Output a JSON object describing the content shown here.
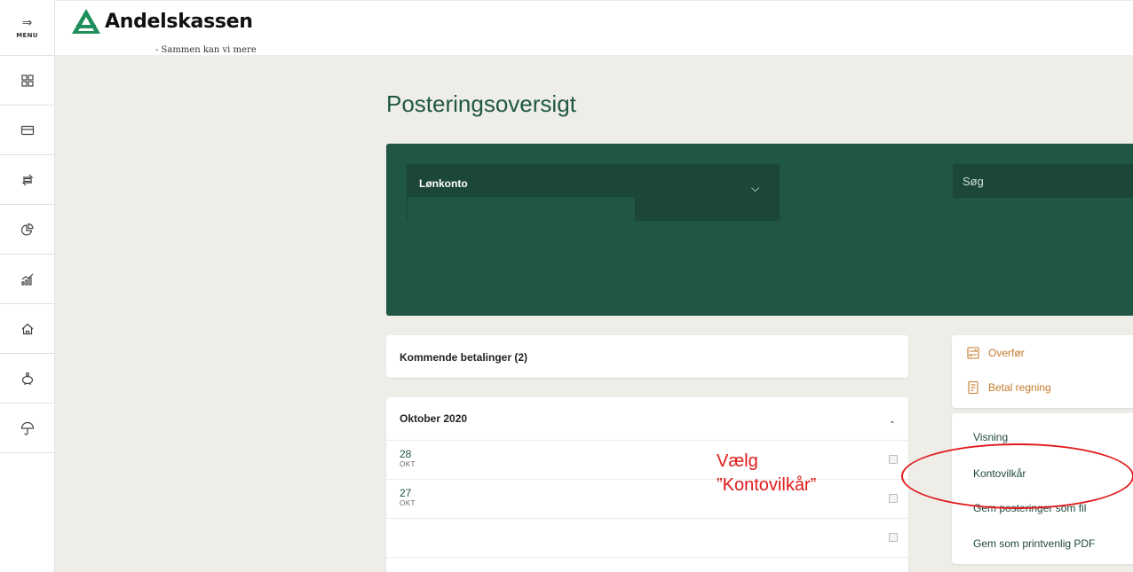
{
  "sidebar": {
    "menu_label": "MENU",
    "items": [
      {
        "icon": "dashboard-icon"
      },
      {
        "icon": "card-icon"
      },
      {
        "icon": "transfer-icon"
      },
      {
        "icon": "pie-chart-icon"
      },
      {
        "icon": "growth-chart-icon"
      },
      {
        "icon": "home-icon"
      },
      {
        "icon": "piggy-bank-icon"
      },
      {
        "icon": "umbrella-icon"
      }
    ]
  },
  "header": {
    "brand": "Andelskassen",
    "tagline": "- Sammen kan vi mere"
  },
  "main": {
    "title": "Posteringsoversigt",
    "account": {
      "name": "Lønkonto"
    },
    "search": {
      "placeholder": "Søg"
    },
    "upcoming": {
      "label": "Kommende betalinger (2)"
    },
    "month_section": {
      "title": "Oktober 2020",
      "rows": [
        {
          "day": "28",
          "month": "OKT"
        },
        {
          "day": "27",
          "month": "OKT"
        },
        {
          "day": "",
          "month": ""
        }
      ]
    },
    "actions": {
      "transfer": "Overfør",
      "pay_bill": "Betal regning"
    },
    "menu": {
      "visning": "Visning",
      "kontovilkaar": "Kontovilkår",
      "save_file": "Gem posteringer som fil",
      "save_pdf": "Gem som printvenlig PDF"
    }
  },
  "annotation": {
    "line1": "Vælg",
    "line2": "”Kontovilkår”",
    "color": "#e01a1a"
  },
  "colors": {
    "brand_green": "#205744",
    "accent_orange": "#c57b2b"
  }
}
